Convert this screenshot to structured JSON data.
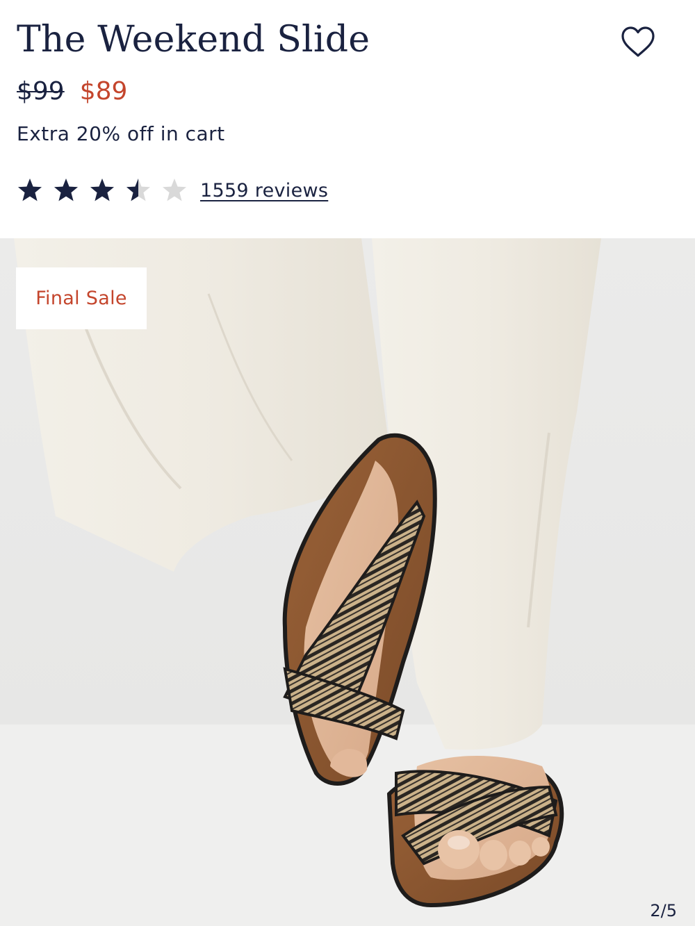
{
  "product": {
    "title": "The Weekend Slide",
    "original_price": "$99",
    "sale_price": "$89",
    "promo_text": "Extra 20% off in cart",
    "rating": 3.5,
    "rating_max": 5,
    "reviews_label": "1559 reviews"
  },
  "image": {
    "badge_label": "Final Sale",
    "counter": "2/5"
  },
  "icons": {
    "wishlist": "heart-outline-icon",
    "star": "star-icon"
  },
  "colors": {
    "navy": "#1a2240",
    "sale_red": "#c4452c",
    "star_empty": "#d9d9d9"
  }
}
